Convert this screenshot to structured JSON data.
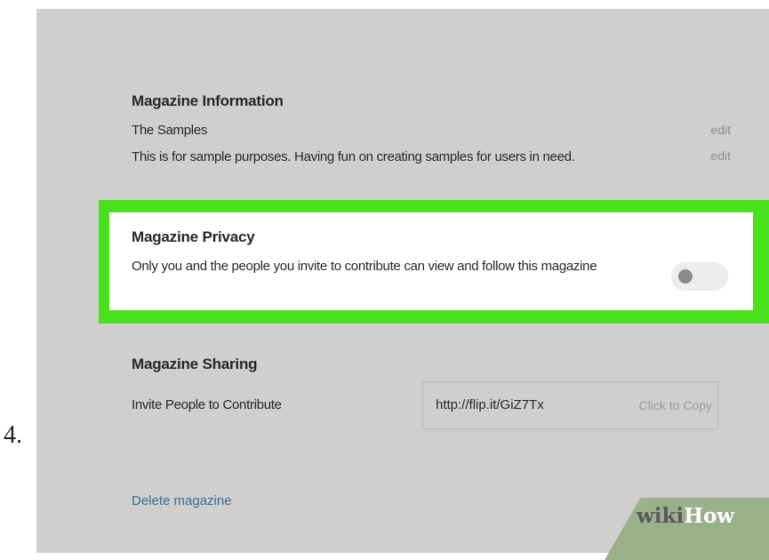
{
  "step_number": "4.",
  "magazine_information": {
    "title": "Magazine Information",
    "name": "The Samples",
    "description": "This is for sample purposes. Having fun on creating samples for users in need.",
    "edit_label": "edit"
  },
  "magazine_privacy": {
    "title": "Magazine Privacy",
    "description": "Only you and the people you invite to contribute can view and follow this magazine",
    "toggle_on": false,
    "highlight_color": "#48e21c"
  },
  "magazine_sharing": {
    "title": "Magazine Sharing",
    "invite_label": "Invite People to Contribute",
    "url": "http://flip.it/GiZ7Tx",
    "copy_label": "Click to Copy"
  },
  "delete_label": "Delete magazine",
  "watermark": {
    "part1": "wiki",
    "part2": "How"
  },
  "colors": {
    "screen_background": "#cfcfcf",
    "link": "#3b6c8c"
  }
}
